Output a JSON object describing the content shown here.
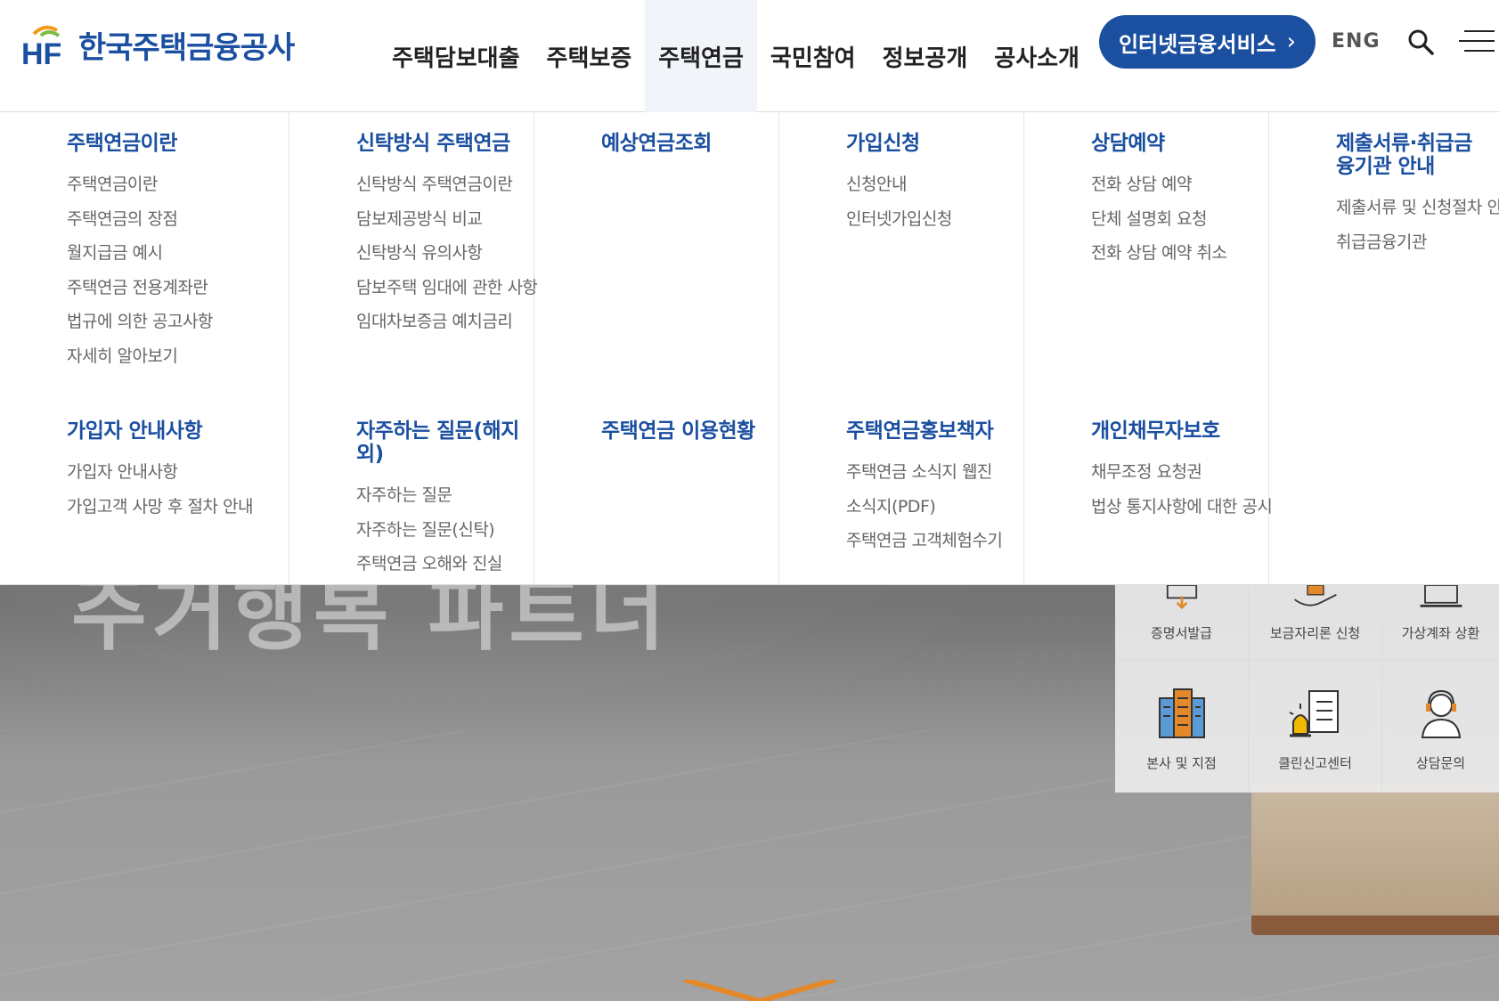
{
  "header": {
    "logo_mark": "HF",
    "logo_text": "한국주택금융공사",
    "nav": [
      "주택담보대출",
      "주택보증",
      "주택연금",
      "국민참여",
      "정보공개",
      "공사소개"
    ],
    "active_nav_index": 2,
    "internet_service_label": "인터넷금융서비스",
    "eng_label": "ENG"
  },
  "mega_menu": {
    "columns": [
      {
        "group1": {
          "title": "주택연금이란",
          "links": [
            "주택연금이란",
            "주택연금의 장점",
            "월지급금 예시",
            "주택연금 전용계좌란",
            "법규에 의한 공고사항",
            "자세히 알아보기"
          ]
        },
        "group2": {
          "title": "가입자 안내사항",
          "links": [
            "가입자 안내사항",
            "가입고객 사망 후 절차 안내"
          ]
        }
      },
      {
        "group1": {
          "title": "신탁방식 주택연금",
          "links": [
            "신탁방식 주택연금이란",
            "담보제공방식 비교",
            "신탁방식 유의사항",
            "담보주택 임대에 관한 사항",
            "임대차보증금 예치금리"
          ]
        },
        "group2": {
          "title": "자주하는 질문(해지 외)",
          "links": [
            "자주하는 질문",
            "자주하는 질문(신탁)",
            "주택연금 오해와 진실"
          ]
        }
      },
      {
        "group1": {
          "title": "예상연금조회",
          "links": []
        },
        "group2": {
          "title": "주택연금 이용현황",
          "links": []
        }
      },
      {
        "group1": {
          "title": "가입신청",
          "links": [
            "신청안내",
            "인터넷가입신청"
          ]
        },
        "group2": {
          "title": "주택연금홍보책자",
          "links": [
            "주택연금 소식지 웹진",
            "소식지(PDF)",
            "주택연금 고객체험수기"
          ]
        }
      },
      {
        "group1": {
          "title": "상담예약",
          "links": [
            "전화 상담 예약",
            "단체 설명회 요청",
            "전화 상담 예약 취소"
          ]
        },
        "group2": {
          "title": "개인채무자보호",
          "links": [
            "채무조정 요청권",
            "법상 통지사항에 대한 공시"
          ]
        }
      },
      {
        "group1": {
          "title": "제출서류·취급금융기관 안내",
          "links": [
            "제출서류 및 신청절차 안내",
            "취급금융기관"
          ]
        },
        "group2": {
          "title": "",
          "links": []
        }
      }
    ]
  },
  "hero": {
    "title_fragment": "주거행복 파트너"
  },
  "quick_menu": {
    "items": [
      "증명서발급",
      "보금자리론 신청",
      "가상계좌 상환",
      "본사 및 지점",
      "클린신고센터",
      "상담문의"
    ],
    "icons": [
      "certificate-icon",
      "hand-house-icon",
      "laptop-icon",
      "building-icon",
      "siren-document-icon",
      "headset-person-icon"
    ]
  },
  "colors": {
    "brand_blue": "#1b4fa0",
    "logo_orange": "#f39a1e",
    "logo_green": "#7dbb42"
  }
}
